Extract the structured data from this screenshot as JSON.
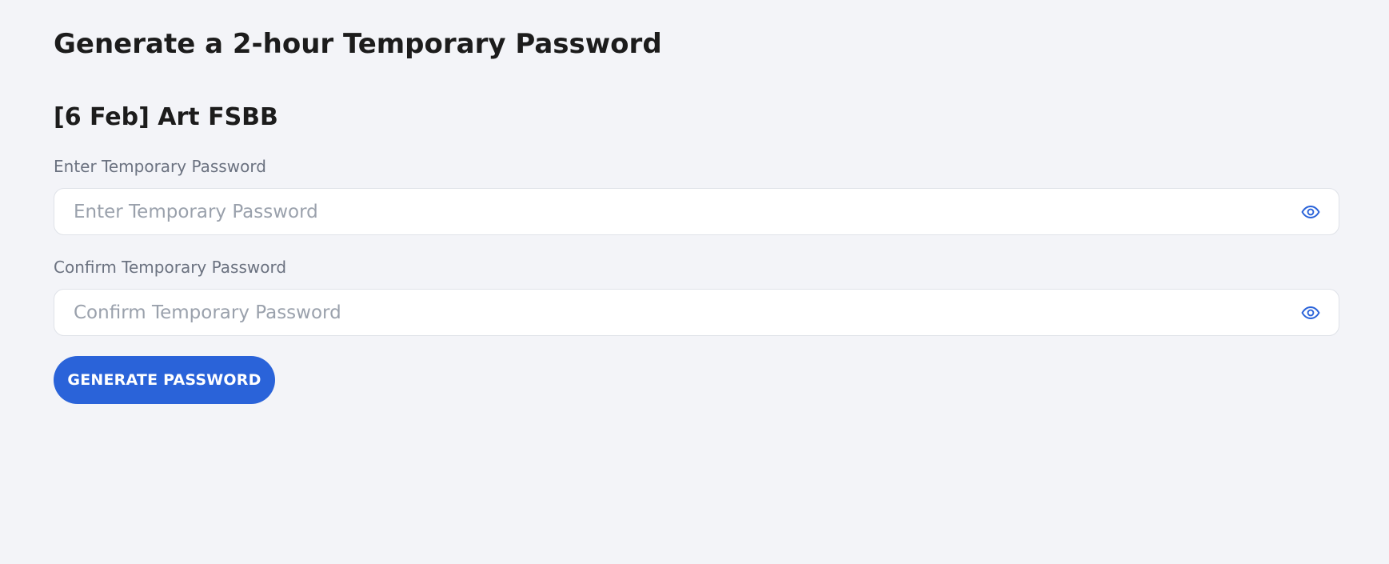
{
  "header": {
    "title": "Generate a 2-hour Temporary Password"
  },
  "section": {
    "title": "[6 Feb] Art FSBB"
  },
  "form": {
    "password": {
      "label": "Enter Temporary Password",
      "placeholder": "Enter Temporary Password",
      "value": "",
      "toggle_icon": "eye-icon"
    },
    "confirm_password": {
      "label": "Confirm Temporary Password",
      "placeholder": "Confirm Temporary Password",
      "value": "",
      "toggle_icon": "eye-icon"
    },
    "submit_label": "GENERATE PASSWORD"
  },
  "colors": {
    "background": "#f3f4f8",
    "accent": "#2a63d9",
    "icon": "#2a63d9"
  }
}
